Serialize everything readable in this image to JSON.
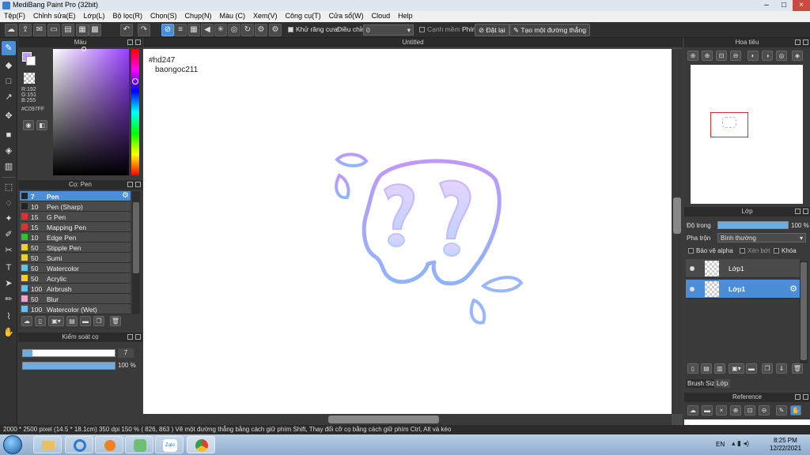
{
  "window": {
    "title": "MediBang Paint Pro (32bit)"
  },
  "menu": [
    "Tệp(F)",
    "Chỉnh sửa(E)",
    "Lớp(L)",
    "Bộ lọc(R)",
    "Chọn(S)",
    "Chụp(N)",
    "Màu (C)",
    "Xem(V)",
    "Công cụ(T)",
    "Cửa sổ(W)",
    "Cloud",
    "Help"
  ],
  "toolbar": {
    "antialias_label": "Khử răng cưa",
    "adjust_label": "Điều chỉnh",
    "adjust_value": "0",
    "snap_label": "Cạnh mềm",
    "key_label": "Phím",
    "reset_label": "Đặt lại",
    "create_line_label": "Tạo một đường thẳng"
  },
  "color": {
    "title": "Màu",
    "r": "R:192",
    "g": "G:151",
    "b": "B:255",
    "hex": "#C097FF",
    "primary_color": "#C097FF",
    "secondary_color": "#ffffff"
  },
  "brush": {
    "title": "Cọ: Pen",
    "items": [
      {
        "size": "7",
        "name": "Pen",
        "color": "#222222",
        "selected": true
      },
      {
        "size": "10",
        "name": "Pen (Sharp)",
        "color": "#222222"
      },
      {
        "size": "15",
        "name": "G Pen",
        "color": "#e03030"
      },
      {
        "size": "15",
        "name": "Mapping Pen",
        "color": "#e03030"
      },
      {
        "size": "10",
        "name": "Edge Pen",
        "color": "#30c030"
      },
      {
        "size": "50",
        "name": "Stipple Pen",
        "color": "#f0d020"
      },
      {
        "size": "50",
        "name": "Sumi",
        "color": "#f0d020"
      },
      {
        "size": "50",
        "name": "Watercolor",
        "color": "#60c0f0"
      },
      {
        "size": "50",
        "name": "Acrylic",
        "color": "#f0d020"
      },
      {
        "size": "100",
        "name": "Airbrush",
        "color": "#60c0f0"
      },
      {
        "size": "50",
        "name": "Blur",
        "color": "#f0a0d0"
      },
      {
        "size": "100",
        "name": "Watercolor (Wet)",
        "color": "#60c0f0"
      }
    ]
  },
  "brush_control": {
    "title": "Kiểm soát cọ",
    "size_value": "7",
    "size_fraction": 0.1,
    "opacity_value": "100 %",
    "opacity_fraction": 1.0
  },
  "canvas": {
    "tab_title": "Untitled",
    "text_line1": "#hd247",
    "text_line2": "baongoc211"
  },
  "navigator": {
    "title": "Hoa tiêu"
  },
  "layers": {
    "title": "Lớp",
    "opacity_label": "Độ trong",
    "opacity_value": "100 %",
    "blend_label": "Pha trộn",
    "blend_value": "Bình thường",
    "protect_alpha": "Bảo vệ alpha",
    "clipping": "Xén bớt",
    "lock": "Khóa",
    "items": [
      {
        "name": "Lớp1",
        "selected": false
      },
      {
        "name": "Lớp1",
        "selected": true
      }
    ],
    "tabs": [
      "Brush Size",
      "Lớp"
    ]
  },
  "reference": {
    "title": "Reference"
  },
  "status": {
    "text": "2000 * 2500 pixel   (14.5 * 18.1cm)   350 dpi   150 %   ( 826, 863 )   Vẽ một đường thẳng bằng cách giữ phím Shift, Thay đổi cỡ cọ bằng cách giữ phím Ctrl, Alt và kéo"
  },
  "taskbar": {
    "lang": "EN",
    "time": "8:25 PM",
    "date": "12/22/2021",
    "zalo_label": "Zalo"
  }
}
